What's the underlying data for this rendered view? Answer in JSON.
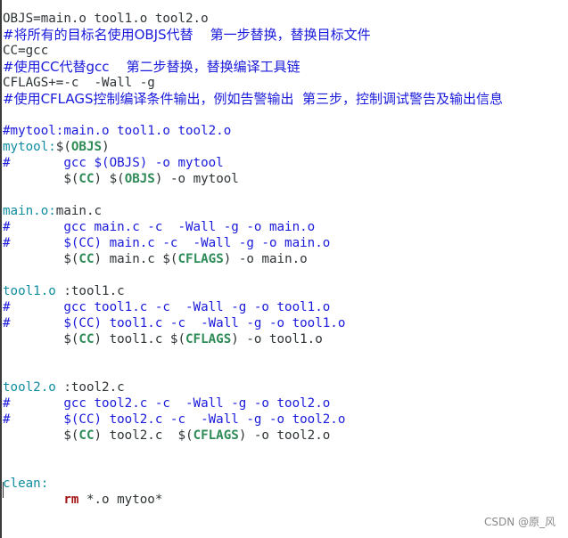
{
  "editor": {
    "lines": [
      {
        "segments": [
          {
            "t": "OBJS=main.o tool1.o tool2.o",
            "c": "plain"
          }
        ]
      },
      {
        "segments": [
          {
            "t": "#将所有的目标名使用OBJS代替    第一步替换，替换目标文件",
            "c": "comment"
          }
        ]
      },
      {
        "segments": [
          {
            "t": "CC=gcc",
            "c": "plain"
          }
        ]
      },
      {
        "segments": [
          {
            "t": "#使用CC代替gcc    第二步替换，替换编译工具链",
            "c": "comment"
          }
        ]
      },
      {
        "segments": [
          {
            "t": "CFLAGS+=-c  -Wall -g",
            "c": "plain"
          }
        ]
      },
      {
        "segments": [
          {
            "t": "#使用CFLAGS控制编译条件输出，例如告警输出  第三步，控制调试警告及输出信息",
            "c": "comment"
          }
        ]
      },
      {
        "segments": []
      },
      {
        "segments": [
          {
            "t": "#mytool:main.o tool1.o tool2.o",
            "c": "comment"
          }
        ]
      },
      {
        "segments": [
          {
            "t": "mytool:",
            "c": "target"
          },
          {
            "t": "$(",
            "c": "plain"
          },
          {
            "t": "OBJS",
            "c": "var"
          },
          {
            "t": ")",
            "c": "plain"
          }
        ]
      },
      {
        "segments": [
          {
            "t": "#       gcc $(OBJS) -o mytool",
            "c": "comment"
          }
        ]
      },
      {
        "segments": [
          {
            "t": "        $(",
            "c": "plain"
          },
          {
            "t": "CC",
            "c": "var"
          },
          {
            "t": ") $(",
            "c": "plain"
          },
          {
            "t": "OBJS",
            "c": "var"
          },
          {
            "t": ") -o mytool",
            "c": "plain"
          }
        ]
      },
      {
        "segments": []
      },
      {
        "segments": [
          {
            "t": "main.o:",
            "c": "target"
          },
          {
            "t": "main.c",
            "c": "plain"
          }
        ]
      },
      {
        "segments": [
          {
            "t": "#       gcc main.c -c  -Wall -g -o main.o",
            "c": "comment"
          }
        ]
      },
      {
        "segments": [
          {
            "t": "#       $(CC) main.c -c  -Wall -g -o main.o",
            "c": "comment"
          }
        ]
      },
      {
        "segments": [
          {
            "t": "        $(",
            "c": "plain"
          },
          {
            "t": "CC",
            "c": "var"
          },
          {
            "t": ") main.c $(",
            "c": "plain"
          },
          {
            "t": "CFLAGS",
            "c": "var"
          },
          {
            "t": ") -o main.o",
            "c": "plain"
          }
        ]
      },
      {
        "segments": []
      },
      {
        "segments": [
          {
            "t": "tool1.o ",
            "c": "target"
          },
          {
            "t": ":tool1.c",
            "c": "plain"
          }
        ]
      },
      {
        "segments": [
          {
            "t": "#       gcc tool1.c -c  -Wall -g -o tool1.o",
            "c": "comment"
          }
        ]
      },
      {
        "segments": [
          {
            "t": "#       $(CC) tool1.c -c  -Wall -g -o tool1.o",
            "c": "comment"
          }
        ]
      },
      {
        "segments": [
          {
            "t": "        $(",
            "c": "plain"
          },
          {
            "t": "CC",
            "c": "var"
          },
          {
            "t": ") tool1.c $(",
            "c": "plain"
          },
          {
            "t": "CFLAGS",
            "c": "var"
          },
          {
            "t": ") -o tool1.o",
            "c": "plain"
          }
        ]
      },
      {
        "segments": []
      },
      {
        "segments": []
      },
      {
        "segments": [
          {
            "t": "tool2.o ",
            "c": "target"
          },
          {
            "t": ":tool2.c",
            "c": "plain"
          }
        ]
      },
      {
        "segments": [
          {
            "t": "#       gcc tool2.c -c  -Wall -g -o tool2.o",
            "c": "comment"
          }
        ]
      },
      {
        "segments": [
          {
            "t": "#       $(CC) tool2.c -c  -Wall -g -o tool2.o",
            "c": "comment"
          }
        ]
      },
      {
        "segments": [
          {
            "t": "        $(",
            "c": "plain"
          },
          {
            "t": "CC",
            "c": "var"
          },
          {
            "t": ") tool2.c  $(",
            "c": "plain"
          },
          {
            "t": "CFLAGS",
            "c": "var"
          },
          {
            "t": ") -o tool2.o",
            "c": "plain"
          }
        ]
      },
      {
        "segments": []
      },
      {
        "segments": []
      },
      {
        "segments": [
          {
            "t": "clean:",
            "c": "target"
          }
        ]
      },
      {
        "segments": [
          {
            "t": "        ",
            "c": "plain"
          },
          {
            "t": "rm",
            "c": "cmd"
          },
          {
            "t": " *.o mytoo*",
            "c": "plain"
          }
        ]
      }
    ]
  },
  "watermark": "CSDN @原_风"
}
